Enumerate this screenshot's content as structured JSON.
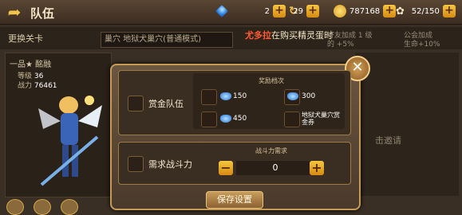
{
  "header": {
    "title": "队伍",
    "resources": [
      {
        "icon": "gem-icon",
        "value": "2"
      },
      {
        "icon": "coin-icon",
        "value": "29"
      },
      {
        "icon": "gold-icon",
        "value": "787168"
      },
      {
        "icon": "stamina-icon",
        "value": "52/150"
      }
    ]
  },
  "stage": {
    "label": "更换关卡",
    "value": "巢穴  地狱犬巢穴(普通模式)"
  },
  "scroll": {
    "name": "尤多拉",
    "text": "在购买精灵蛋时"
  },
  "bonus": [
    {
      "line1": "好友加成 1 级",
      "line2": "的 +5%"
    },
    {
      "line1": "公会加成",
      "line2": "生命+10%"
    }
  ],
  "character": {
    "rank": "一品★ 酩融",
    "level_label": "等级",
    "level": "36",
    "power_label": "战力",
    "power": "76461"
  },
  "right_panel": {
    "invite": "击邀请"
  },
  "dialog": {
    "reward": {
      "label": "赏金队伍",
      "ribbon": "奖励档次",
      "items": [
        {
          "value": "150"
        },
        {
          "value": "300"
        },
        {
          "value": "450"
        },
        {
          "value": "地狱犬巢穴赏金券"
        }
      ]
    },
    "power": {
      "label": "需求战斗力",
      "ribbon": "战斗力需求",
      "value": "0"
    },
    "save_label": "保存设置"
  }
}
